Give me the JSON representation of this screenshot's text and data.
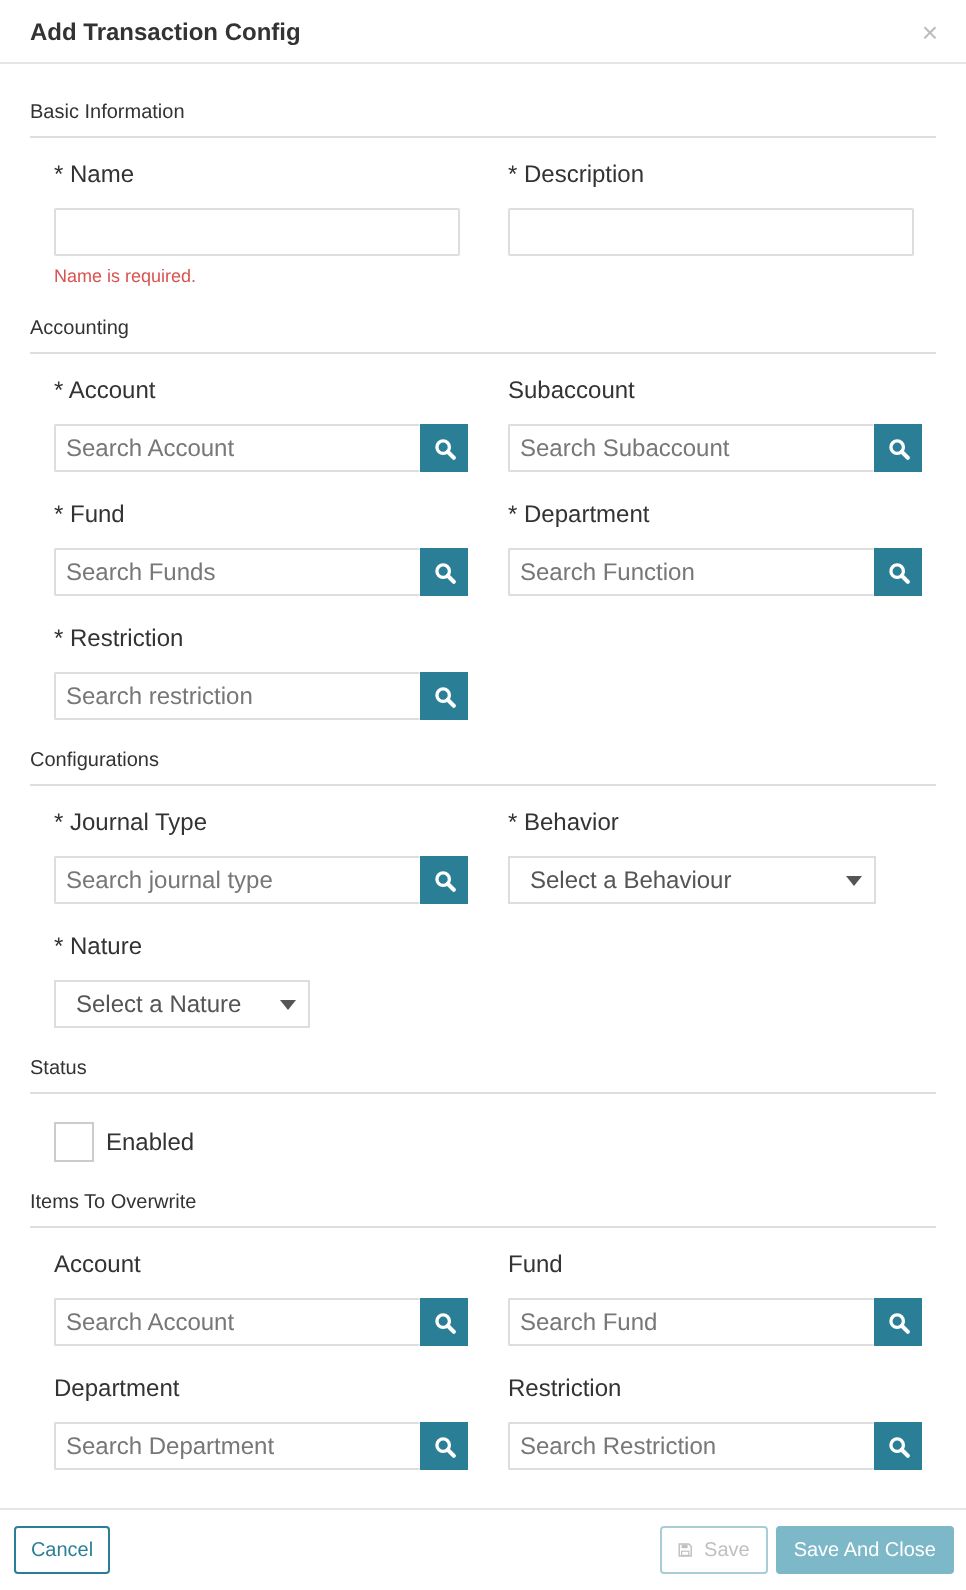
{
  "dialog": {
    "title": "Add Transaction Config",
    "close": "×"
  },
  "sections": [
    {
      "title": "Basic Information",
      "fields": [
        {
          "kind": "text",
          "label": "* Name",
          "error": "Name is required."
        },
        {
          "kind": "text",
          "label": "* Description"
        }
      ]
    },
    {
      "title": "Accounting",
      "fields": [
        {
          "kind": "search",
          "label": "* Account",
          "placeholder": "Search Account"
        },
        {
          "kind": "search",
          "label": "Subaccount",
          "placeholder": "Search Subaccount"
        },
        {
          "kind": "search",
          "label": "* Fund",
          "placeholder": "Search Funds"
        },
        {
          "kind": "search",
          "label": "* Department",
          "placeholder": "Search Function"
        },
        {
          "kind": "search",
          "label": "* Restriction",
          "placeholder": "Search restriction"
        }
      ]
    },
    {
      "title": "Configurations",
      "fields": [
        {
          "kind": "search",
          "label": "* Journal Type",
          "placeholder": "Search journal type"
        },
        {
          "kind": "select",
          "label": "* Behavior",
          "placeholder": "Select a Behaviour"
        },
        {
          "kind": "select",
          "label": "* Nature",
          "placeholder": "Select a Nature"
        }
      ]
    },
    {
      "title": "Status",
      "fields": [
        {
          "kind": "checkbox",
          "label": "Enabled",
          "checked": false
        }
      ]
    },
    {
      "title": "Items To Overwrite",
      "fields": [
        {
          "kind": "search",
          "label": "Account",
          "placeholder": "Search Account"
        },
        {
          "kind": "search",
          "label": "Fund",
          "placeholder": "Search Fund"
        },
        {
          "kind": "search",
          "label": "Department",
          "placeholder": "Search Department"
        },
        {
          "kind": "search",
          "label": "Restriction",
          "placeholder": "Search Restriction"
        }
      ]
    }
  ],
  "footer": {
    "cancel": {
      "label": "Cancel",
      "disabled": false
    },
    "save": {
      "label": "Save",
      "disabled": true
    },
    "save_close": {
      "label": "Save And Close",
      "disabled": true
    }
  }
}
